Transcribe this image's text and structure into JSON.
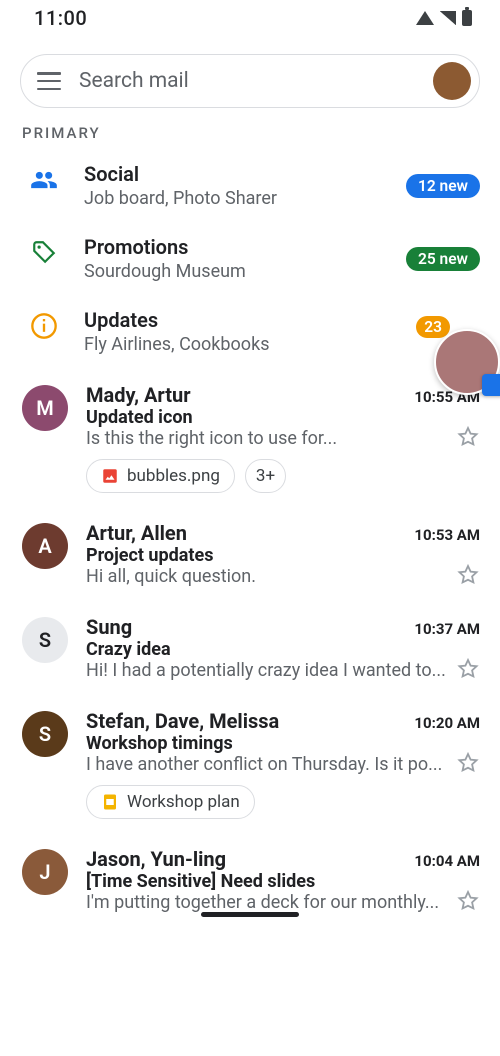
{
  "status": {
    "time": "11:00"
  },
  "search": {
    "placeholder": "Search mail"
  },
  "section_label": "PRIMARY",
  "tabs": [
    {
      "title": "Social",
      "sub": "Job board, Photo Sharer",
      "badge": "12 new",
      "badge_color": "blue",
      "icon": "people"
    },
    {
      "title": "Promotions",
      "sub": "Sourdough Museum",
      "badge": "25 new",
      "badge_color": "green",
      "icon": "tag"
    },
    {
      "title": "Updates",
      "sub": "Fly Airlines, Cookbooks",
      "badge": "23",
      "badge_color": "orange",
      "icon": "info"
    }
  ],
  "emails": [
    {
      "sender": "Mady, Artur",
      "time": "10:55 AM",
      "subject": "Updated icon",
      "snippet": "Is this the right icon to use for...",
      "avatar_initial": "M",
      "avatar_bg": "#8c4a6e",
      "attachments": [
        {
          "label": "bubbles.png",
          "icon": "image"
        }
      ],
      "extra": "3+"
    },
    {
      "sender": "Artur, Allen",
      "time": "10:53 AM",
      "subject": "Project updates",
      "snippet": "Hi all, quick question.",
      "avatar_initial": "A",
      "avatar_bg": "#6d3b2f"
    },
    {
      "sender": "Sung",
      "time": "10:37 AM",
      "subject": "Crazy idea",
      "snippet": "Hi! I had a potentially crazy idea I wanted to...",
      "avatar_initial": "S",
      "avatar_bg": "#e8eaed",
      "avatar_fg": "#202124"
    },
    {
      "sender": "Stefan, Dave, Melissa",
      "time": "10:20 AM",
      "subject": "Workshop timings",
      "snippet": "I have another conflict on Thursday. Is it po...",
      "avatar_initial": "S",
      "avatar_bg": "#5a3a1a",
      "attachments": [
        {
          "label": "Workshop plan",
          "icon": "slides"
        }
      ]
    },
    {
      "sender": "Jason, Yun-ling",
      "time": "10:04 AM",
      "subject": "[Time Sensitive] Need slides",
      "snippet": "I'm putting together a deck for our monthly...",
      "avatar_initial": "J",
      "avatar_bg": "#8a5a3a"
    }
  ]
}
